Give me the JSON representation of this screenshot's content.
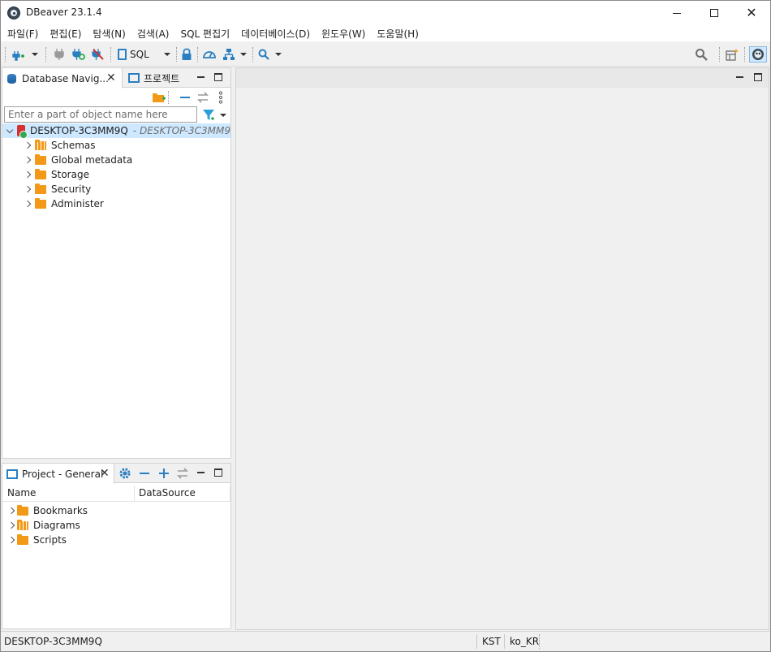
{
  "window": {
    "title": "DBeaver 23.1.4"
  },
  "menu": [
    {
      "label": "파일(F)"
    },
    {
      "label": "편집(E)"
    },
    {
      "label": "탐색(N)"
    },
    {
      "label": "검색(A)"
    },
    {
      "label": "SQL 편집기"
    },
    {
      "label": "데이터베이스(D)"
    },
    {
      "label": "윈도우(W)"
    },
    {
      "label": "도움말(H)"
    }
  ],
  "toolbar": {
    "sql_label": "SQL"
  },
  "navigator": {
    "tab_label": "Database Navig...",
    "projects_tab_label": "프로젝트",
    "filter_placeholder": "Enter a part of object name here",
    "connection": {
      "name": "DESKTOP-3C3MM9Q",
      "subtitle": "- DESKTOP-3C3MM9"
    },
    "nodes": [
      {
        "label": "Schemas"
      },
      {
        "label": "Global metadata"
      },
      {
        "label": "Storage"
      },
      {
        "label": "Security"
      },
      {
        "label": "Administer"
      }
    ]
  },
  "project": {
    "tab_label": "Project - General",
    "columns": [
      {
        "label": "Name"
      },
      {
        "label": "DataSource"
      }
    ],
    "items": [
      {
        "label": "Bookmarks"
      },
      {
        "label": "Diagrams"
      },
      {
        "label": "Scripts"
      }
    ]
  },
  "status": {
    "connection": "DESKTOP-3C3MM9Q",
    "timezone": "KST",
    "locale": "ko_KR"
  },
  "colors": {
    "accent": "#2a7fc1",
    "folder": "#f29a17",
    "selection": "#cde8ff",
    "connection": "#d63131"
  }
}
